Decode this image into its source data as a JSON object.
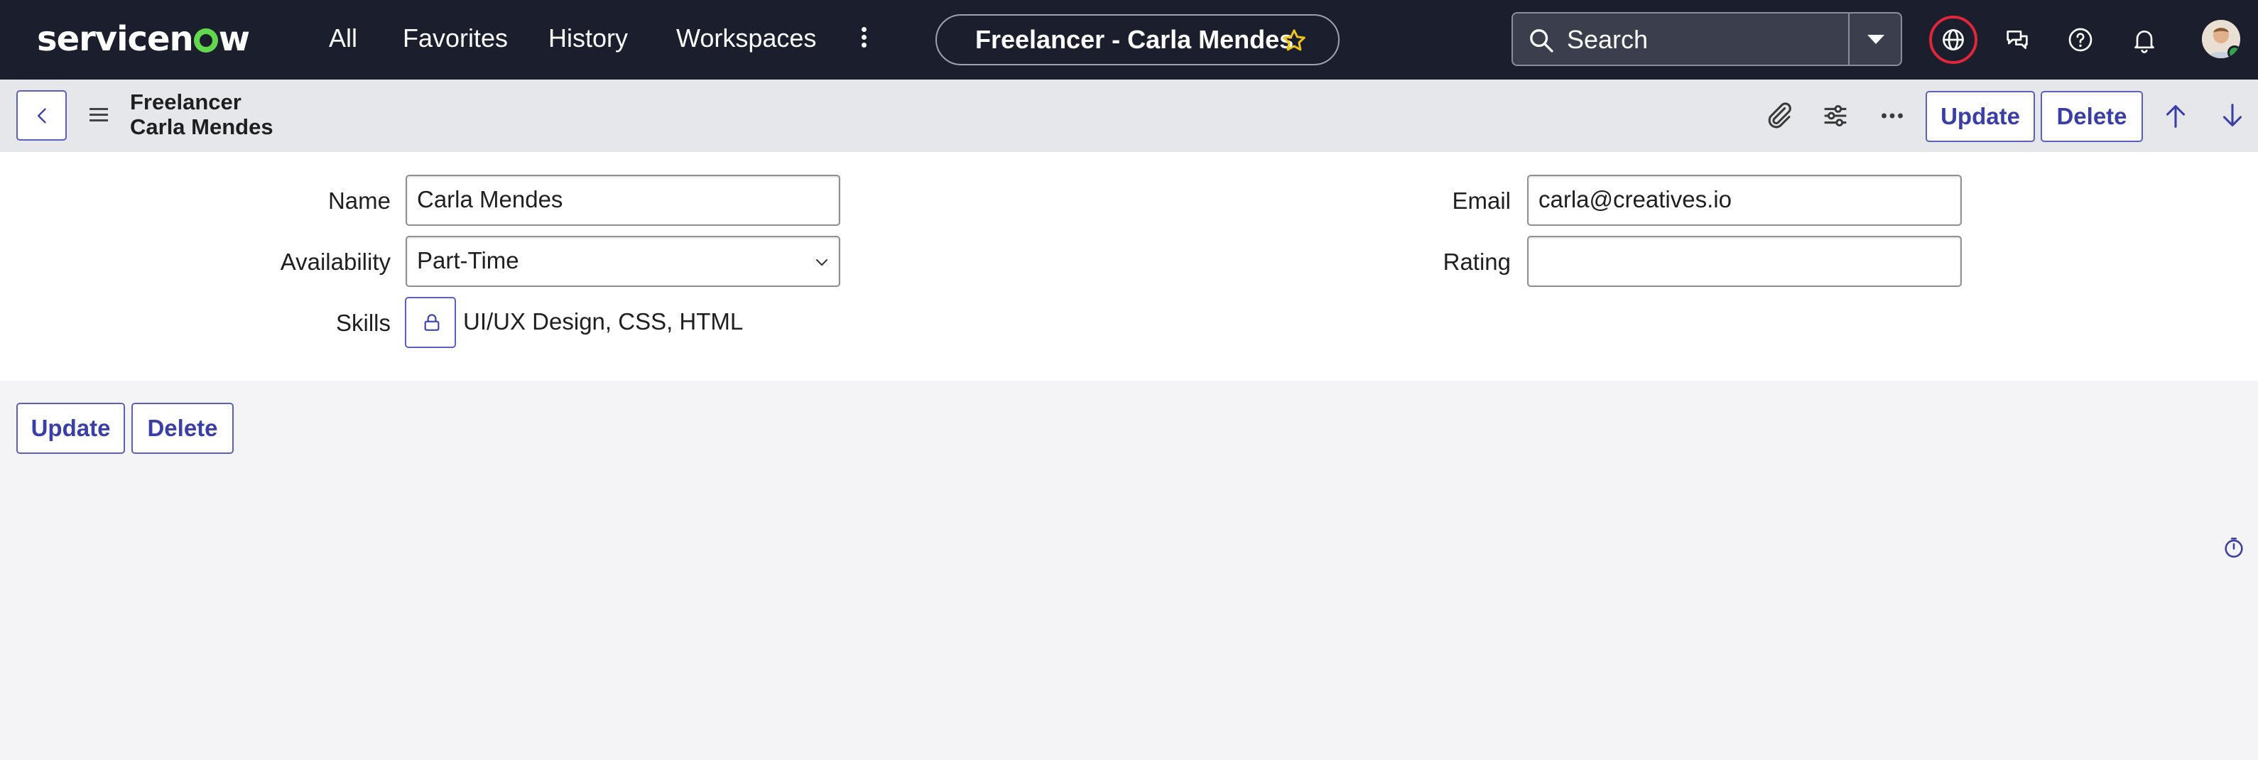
{
  "nav": {
    "logo": "servicenow",
    "links": [
      "All",
      "Favorites",
      "History",
      "Workspaces"
    ],
    "record_title": "Freelancer - Carla Mendes",
    "search_placeholder": "Search"
  },
  "header": {
    "table": "Freelancer",
    "record": "Carla Mendes",
    "update_label": "Update",
    "delete_label": "Delete"
  },
  "form": {
    "name_label": "Name",
    "name_value": "Carla Mendes",
    "email_label": "Email",
    "email_value": "carla@creatives.io",
    "availability_label": "Availability",
    "availability_value": "Part-Time",
    "rating_label": "Rating",
    "rating_value": "",
    "skills_label": "Skills",
    "skills_value": "UI/UX Design, CSS, HTML"
  },
  "footer": {
    "update_label": "Update",
    "delete_label": "Delete"
  },
  "colors": {
    "nav_bg": "#1b1e2c",
    "accent": "#5b5fbf",
    "logo_green": "#62d84e",
    "globe_ring": "#e0263a",
    "header_bg": "#e6e7eb"
  },
  "icons": [
    "search-icon",
    "chevron-down-icon",
    "globe-icon",
    "chat-icon",
    "help-icon",
    "bell-icon",
    "back-icon",
    "paperclip-icon",
    "sliders-icon",
    "more-icon",
    "arrow-up-icon",
    "arrow-down-icon",
    "lock-icon",
    "timer-icon",
    "star-icon"
  ]
}
